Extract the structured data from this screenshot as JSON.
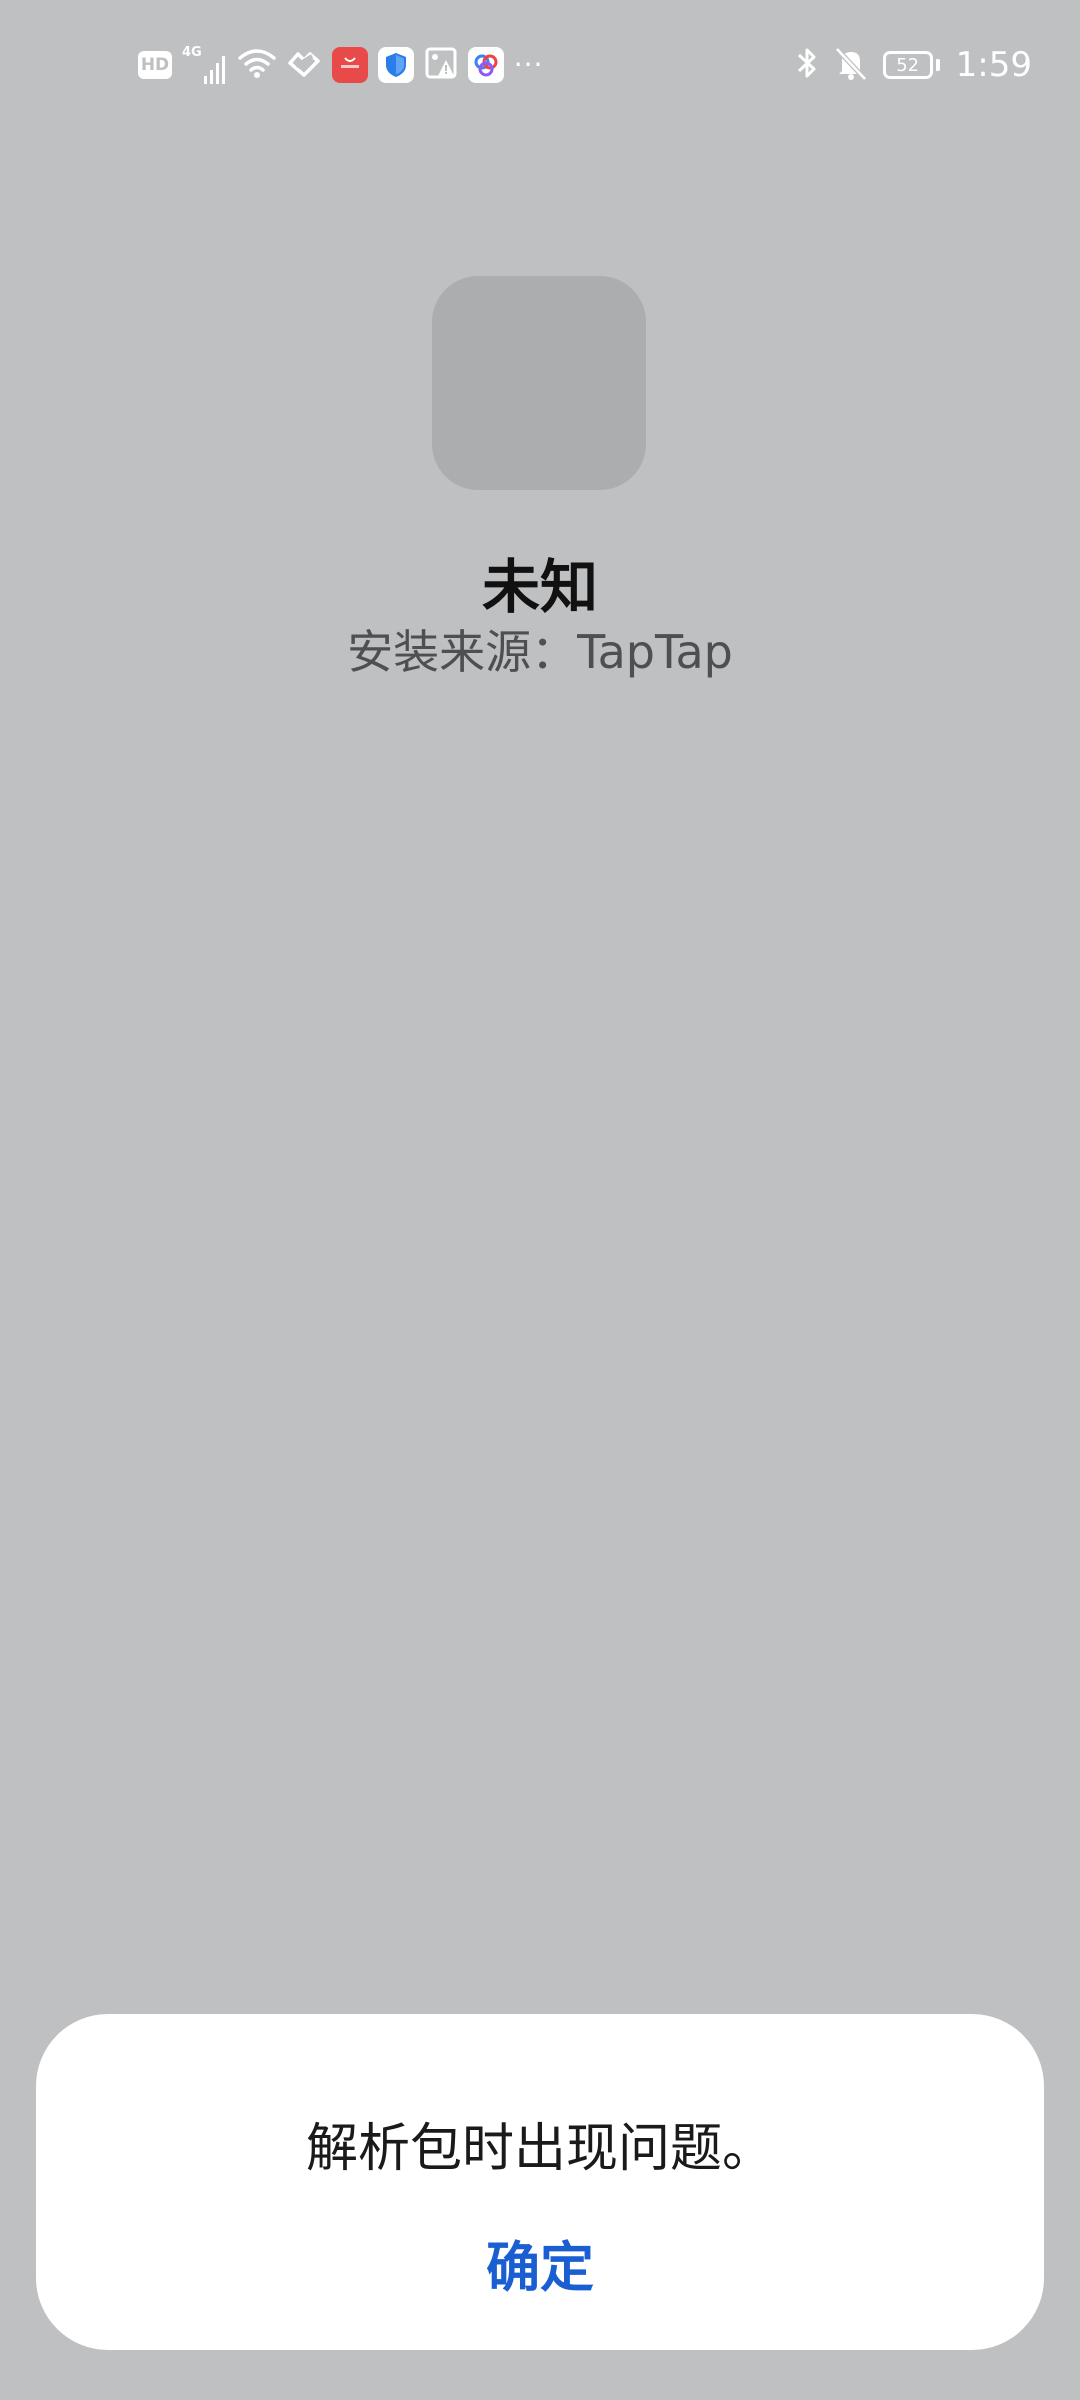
{
  "status_bar": {
    "hd_label": "HD",
    "network_label": "4G",
    "more_indicator": "···",
    "battery_level": "52",
    "time": "1:59",
    "icons": [
      "hd-icon",
      "signal-icon",
      "wifi-icon",
      "heart-pulse-icon",
      "huawei-appgallery-icon",
      "shield-icon",
      "image-alert-icon",
      "app-circles-icon",
      "bluetooth-icon",
      "bell-muted-icon",
      "battery-icon"
    ]
  },
  "app": {
    "name": "未知",
    "install_source": "安装来源：TapTap"
  },
  "dialog": {
    "message": "解析包时出现问题。",
    "confirm_label": "确定"
  },
  "colors": {
    "background": "#bfc0c2",
    "accent": "#1a5fd2",
    "dialog_bg": "#ffffff"
  }
}
